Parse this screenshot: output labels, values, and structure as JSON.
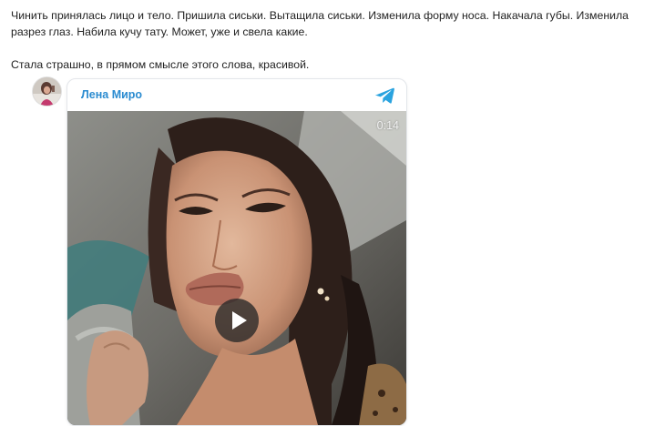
{
  "article": {
    "paragraph_1": "Чинить принялась лицо и тело. Пришила сиськи. Вытащила сиськи. Изменила форму носа. Накачала губы. Изменила разрез глаз. Набила кучу тату. Может, уже и свела какие.",
    "paragraph_2": "Стала страшно, в прямом смысле этого слова, красивой."
  },
  "embed": {
    "channel_name": "Лена Миро",
    "platform_icon": "telegram-icon",
    "video": {
      "duration": "0:14",
      "play_icon": "play-icon"
    }
  },
  "colors": {
    "link": "#2a8bd0",
    "telegram": "#2aa3df",
    "card_border": "#e3e6ea"
  }
}
